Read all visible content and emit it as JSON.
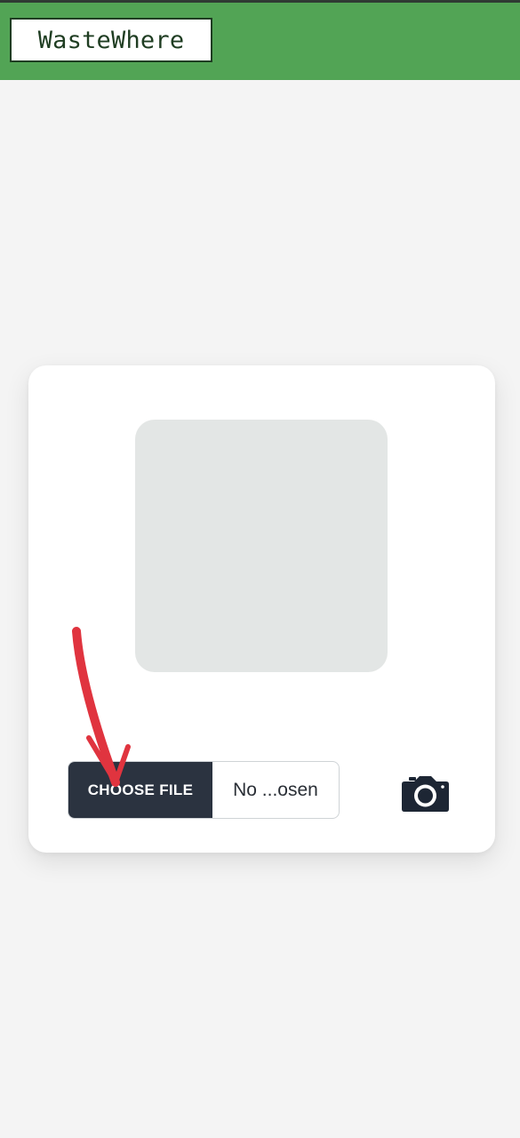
{
  "header": {
    "logo_text": "WasteWhere",
    "background_color": "#52a455"
  },
  "upload": {
    "choose_file_label": "CHOOSE FILE",
    "file_status": "No ...osen"
  },
  "icons": {
    "camera": "camera-icon",
    "annotation": "red-arrow-annotation"
  }
}
